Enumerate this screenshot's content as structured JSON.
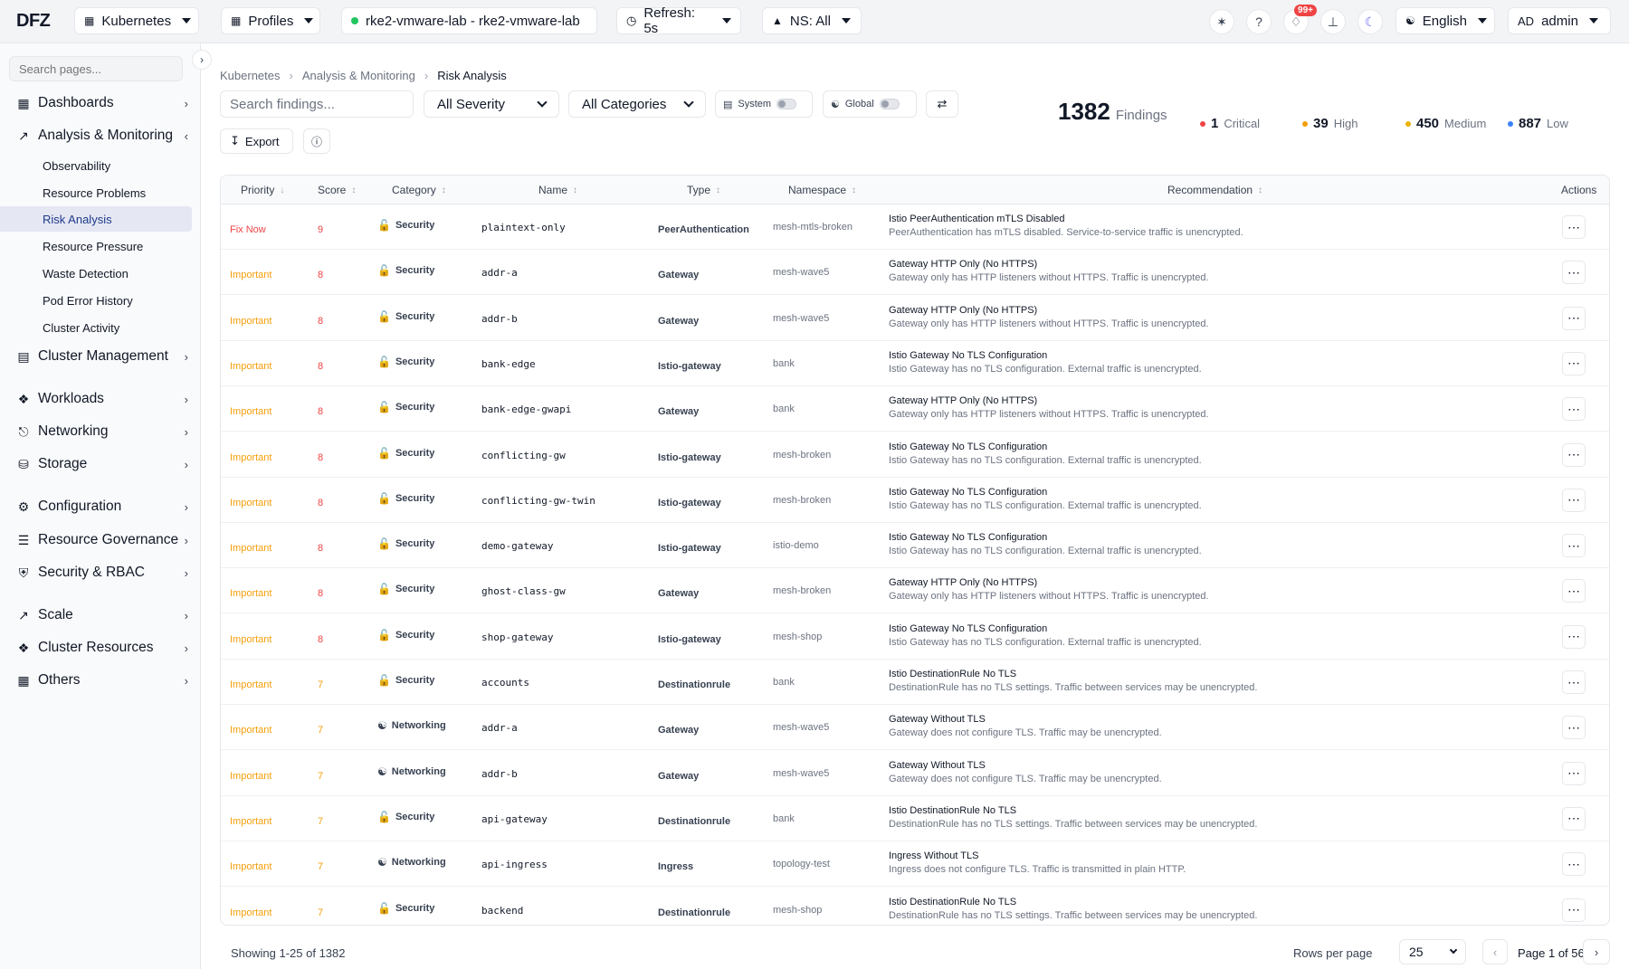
{
  "app": {
    "logo": "DFZ"
  },
  "topbar": {
    "cluster_selector": "Kubernetes",
    "profiles": "Profiles",
    "context": "rke2-vmware-lab - rke2-vmware-lab",
    "refresh": "Refresh: 5s",
    "namespace": "NS: All",
    "notifications_badge": "99+",
    "language": "English",
    "user_initials": "AD",
    "user_name": "admin"
  },
  "sidebar": {
    "search_placeholder": "Search pages...",
    "items": [
      {
        "label": "Dashboards"
      },
      {
        "label": "Analysis & Monitoring"
      },
      {
        "label": "Cluster Management"
      },
      {
        "label": "Workloads"
      },
      {
        "label": "Networking"
      },
      {
        "label": "Storage"
      },
      {
        "label": "Configuration"
      },
      {
        "label": "Resource Governance"
      },
      {
        "label": "Security & RBAC"
      },
      {
        "label": "Scale"
      },
      {
        "label": "Cluster Resources"
      },
      {
        "label": "Others"
      }
    ],
    "sub_items": [
      {
        "label": "Observability"
      },
      {
        "label": "Resource Problems"
      },
      {
        "label": "Risk Analysis"
      },
      {
        "label": "Resource Pressure"
      },
      {
        "label": "Waste Detection"
      },
      {
        "label": "Pod Error History"
      },
      {
        "label": "Cluster Activity"
      }
    ]
  },
  "breadcrumb": [
    "Kubernetes",
    "Analysis & Monitoring",
    "Risk Analysis"
  ],
  "filters": {
    "search_placeholder": "Search findings...",
    "severity": "All Severity",
    "categories": "All Categories",
    "system_label": "System",
    "global_label": "Global",
    "export_label": "Export"
  },
  "summary": {
    "total": "1382",
    "total_label": "Findings",
    "critical": "1",
    "critical_label": "Critical",
    "high": "39",
    "high_label": "High",
    "medium": "450",
    "medium_label": "Medium",
    "low": "887",
    "low_label": "Low"
  },
  "colors": {
    "critical": "#ef4444",
    "high": "#f59e0b",
    "medium": "#eab308",
    "low": "#3b82f6",
    "active_nav": "#1e3a8a"
  },
  "table": {
    "headers": {
      "priority": "Priority",
      "score": "Score",
      "category": "Category",
      "name": "Name",
      "type": "Type",
      "namespace": "Namespace",
      "recommendation": "Recommendation",
      "actions": "Actions"
    },
    "rows": [
      {
        "priority": "Fix Now",
        "score": "9",
        "category": "Security",
        "name": "plaintext-only",
        "type": "PeerAuthentication",
        "namespace": "mesh-mtls-broken",
        "rec_title": "Istio PeerAuthentication mTLS Disabled",
        "rec_desc": "PeerAuthentication has mTLS disabled. Service-to-service traffic is unencrypted."
      },
      {
        "priority": "Important",
        "score": "8",
        "category": "Security",
        "name": "addr-a",
        "type": "Gateway",
        "namespace": "mesh-wave5",
        "rec_title": "Gateway HTTP Only (No HTTPS)",
        "rec_desc": "Gateway only has HTTP listeners without HTTPS. Traffic is unencrypted."
      },
      {
        "priority": "Important",
        "score": "8",
        "category": "Security",
        "name": "addr-b",
        "type": "Gateway",
        "namespace": "mesh-wave5",
        "rec_title": "Gateway HTTP Only (No HTTPS)",
        "rec_desc": "Gateway only has HTTP listeners without HTTPS. Traffic is unencrypted."
      },
      {
        "priority": "Important",
        "score": "8",
        "category": "Security",
        "name": "bank-edge",
        "type": "Istio-gateway",
        "namespace": "bank",
        "rec_title": "Istio Gateway No TLS Configuration",
        "rec_desc": "Istio Gateway has no TLS configuration. External traffic is unencrypted."
      },
      {
        "priority": "Important",
        "score": "8",
        "category": "Security",
        "name": "bank-edge-gwapi",
        "type": "Gateway",
        "namespace": "bank",
        "rec_title": "Gateway HTTP Only (No HTTPS)",
        "rec_desc": "Gateway only has HTTP listeners without HTTPS. Traffic is unencrypted."
      },
      {
        "priority": "Important",
        "score": "8",
        "category": "Security",
        "name": "conflicting-gw",
        "type": "Istio-gateway",
        "namespace": "mesh-broken",
        "rec_title": "Istio Gateway No TLS Configuration",
        "rec_desc": "Istio Gateway has no TLS configuration. External traffic is unencrypted."
      },
      {
        "priority": "Important",
        "score": "8",
        "category": "Security",
        "name": "conflicting-gw-twin",
        "type": "Istio-gateway",
        "namespace": "mesh-broken",
        "rec_title": "Istio Gateway No TLS Configuration",
        "rec_desc": "Istio Gateway has no TLS configuration. External traffic is unencrypted."
      },
      {
        "priority": "Important",
        "score": "8",
        "category": "Security",
        "name": "demo-gateway",
        "type": "Istio-gateway",
        "namespace": "istio-demo",
        "rec_title": "Istio Gateway No TLS Configuration",
        "rec_desc": "Istio Gateway has no TLS configuration. External traffic is unencrypted."
      },
      {
        "priority": "Important",
        "score": "8",
        "category": "Security",
        "name": "ghost-class-gw",
        "type": "Gateway",
        "namespace": "mesh-broken",
        "rec_title": "Gateway HTTP Only (No HTTPS)",
        "rec_desc": "Gateway only has HTTP listeners without HTTPS. Traffic is unencrypted."
      },
      {
        "priority": "Important",
        "score": "8",
        "category": "Security",
        "name": "shop-gateway",
        "type": "Istio-gateway",
        "namespace": "mesh-shop",
        "rec_title": "Istio Gateway No TLS Configuration",
        "rec_desc": "Istio Gateway has no TLS configuration. External traffic is unencrypted."
      },
      {
        "priority": "Important",
        "score": "7",
        "category": "Security",
        "name": "accounts",
        "type": "Destinationrule",
        "namespace": "bank",
        "rec_title": "Istio DestinationRule No TLS",
        "rec_desc": "DestinationRule has no TLS settings. Traffic between services may be unencrypted."
      },
      {
        "priority": "Important",
        "score": "7",
        "category": "Networking",
        "name": "addr-a",
        "type": "Gateway",
        "namespace": "mesh-wave5",
        "rec_title": "Gateway Without TLS",
        "rec_desc": "Gateway does not configure TLS. Traffic may be unencrypted."
      },
      {
        "priority": "Important",
        "score": "7",
        "category": "Networking",
        "name": "addr-b",
        "type": "Gateway",
        "namespace": "mesh-wave5",
        "rec_title": "Gateway Without TLS",
        "rec_desc": "Gateway does not configure TLS. Traffic may be unencrypted."
      },
      {
        "priority": "Important",
        "score": "7",
        "category": "Security",
        "name": "api-gateway",
        "type": "Destinationrule",
        "namespace": "bank",
        "rec_title": "Istio DestinationRule No TLS",
        "rec_desc": "DestinationRule has no TLS settings. Traffic between services may be unencrypted."
      },
      {
        "priority": "Important",
        "score": "7",
        "category": "Networking",
        "name": "api-ingress",
        "type": "Ingress",
        "namespace": "topology-test",
        "rec_title": "Ingress Without TLS",
        "rec_desc": "Ingress does not configure TLS. Traffic is transmitted in plain HTTP."
      },
      {
        "priority": "Important",
        "score": "7",
        "category": "Security",
        "name": "backend",
        "type": "Destinationrule",
        "namespace": "mesh-shop",
        "rec_title": "Istio DestinationRule No TLS",
        "rec_desc": "DestinationRule has no TLS settings. Traffic between services may be unencrypted."
      }
    ]
  },
  "footer": {
    "showing": "Showing 1-25 of 1382",
    "rows_per_page_label": "Rows per page",
    "rows_per_page": "25",
    "page": "Page 1 of 56"
  }
}
